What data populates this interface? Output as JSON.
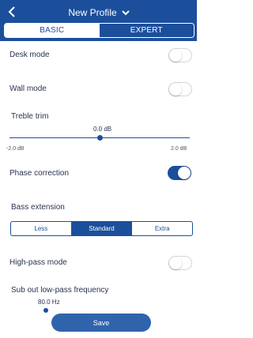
{
  "header": {
    "title": "New Profile",
    "back_icon": "chevron-left-icon",
    "dropdown_icon": "chevron-down-icon",
    "tabs": [
      {
        "label": "BASIC",
        "active": true
      },
      {
        "label": "EXPERT",
        "active": false
      }
    ]
  },
  "settings": {
    "desk_mode": {
      "label": "Desk mode",
      "on": false
    },
    "wall_mode": {
      "label": "Wall mode",
      "on": false
    },
    "treble_trim": {
      "label": "Treble trim",
      "value": "0.0 dB",
      "min": "-2.0 dB",
      "max": "2.0 dB",
      "level_fraction": 0.5
    },
    "phase_correction": {
      "label": "Phase correction",
      "on": true
    },
    "bass_extension": {
      "label": "Bass extension",
      "options": [
        "Less",
        "Standard",
        "Extra"
      ],
      "selected": "Standard"
    },
    "high_pass_mode": {
      "label": "High-pass mode",
      "on": false
    },
    "sub_out_low_pass": {
      "label": "Sub out low-pass frequency",
      "value": "80.0 Hz"
    }
  },
  "footer": {
    "save_label": "Save"
  },
  "colors": {
    "accent": "#1b4f9c",
    "button": "#2f64ad"
  }
}
